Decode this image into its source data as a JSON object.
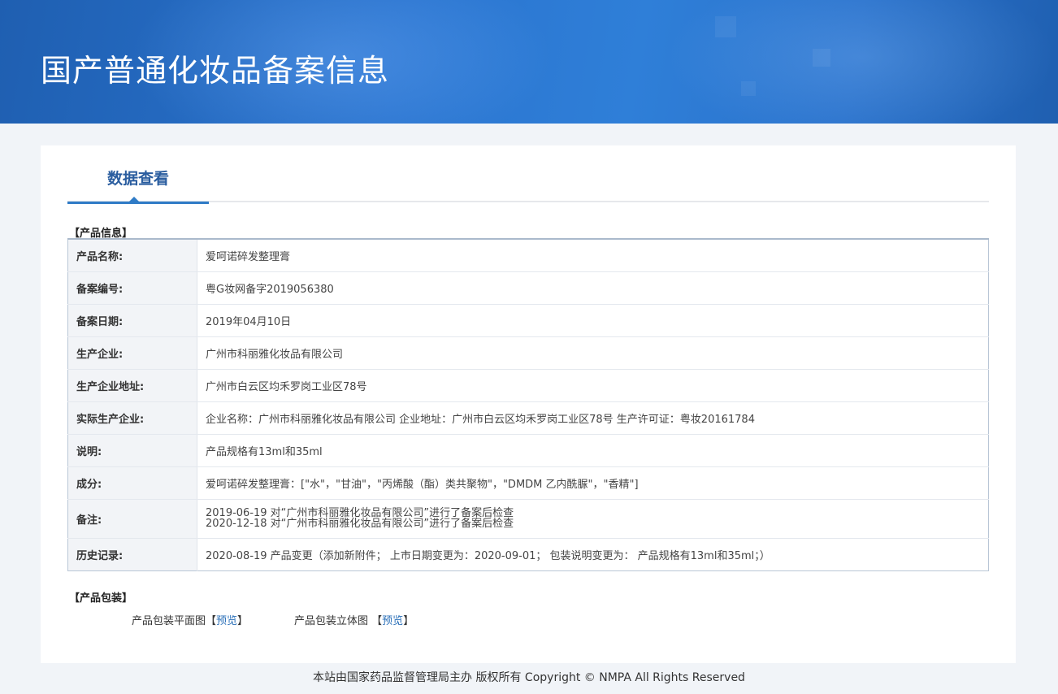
{
  "header": {
    "title": "国产普通化妆品备案信息"
  },
  "tab": {
    "label": "数据查看"
  },
  "product_info": {
    "section_label": "【产品信息】",
    "rows": [
      {
        "key": "产品名称:",
        "value": "爱呵诺碎发整理膏"
      },
      {
        "key": "备案编号:",
        "value": "粤G妆网备字2019056380"
      },
      {
        "key": "备案日期:",
        "value": "2019年04月10日"
      },
      {
        "key": "生产企业:",
        "value": "广州市科丽雅化妆品有限公司"
      },
      {
        "key": "生产企业地址:",
        "value": "广州市白云区均禾罗岗工业区78号"
      },
      {
        "key": "实际生产企业:",
        "value": "企业名称：广州市科丽雅化妆品有限公司 企业地址：广州市白云区均禾罗岗工业区78号 生产许可证：粤妆20161784"
      },
      {
        "key": "说明:",
        "value": "产品规格有13ml和35ml"
      },
      {
        "key": "成分:",
        "value": "爱呵诺碎发整理膏：[\"水\"，\"甘油\"，\"丙烯酸（酯）类共聚物\"，\"DMDM 乙内酰脲\"，\"香精\"]"
      },
      {
        "key": "备注:",
        "lines": [
          "2019-06-19 对“广州市科丽雅化妆品有限公司”进行了备案后检查",
          "2020-12-18 对“广州市科丽雅化妆品有限公司”进行了备案后检查"
        ]
      },
      {
        "key": "历史记录:",
        "value": "2020-08-19 产品变更（添加新附件； 上市日期变更为：2020-09-01； 包装说明变更为： 产品规格有13ml和35ml；）"
      }
    ]
  },
  "packaging": {
    "section_label": "【产品包装】",
    "items": [
      {
        "label": "产品包装平面图",
        "bracket_open": "【",
        "link": "预览",
        "bracket_close": "】"
      },
      {
        "label": "产品包装立体图",
        "bracket_open": "【",
        "link": "预览",
        "bracket_close": "】"
      }
    ]
  },
  "footer": {
    "text": "本站由国家药品监督管理局主办 版权所有 Copyright © NMPA All Rights Reserved"
  },
  "colors": {
    "banner": "#2a72cc",
    "tab_text": "#2a5d9f",
    "link": "#2a6fb8",
    "key_bg": "#f2f4f7"
  }
}
